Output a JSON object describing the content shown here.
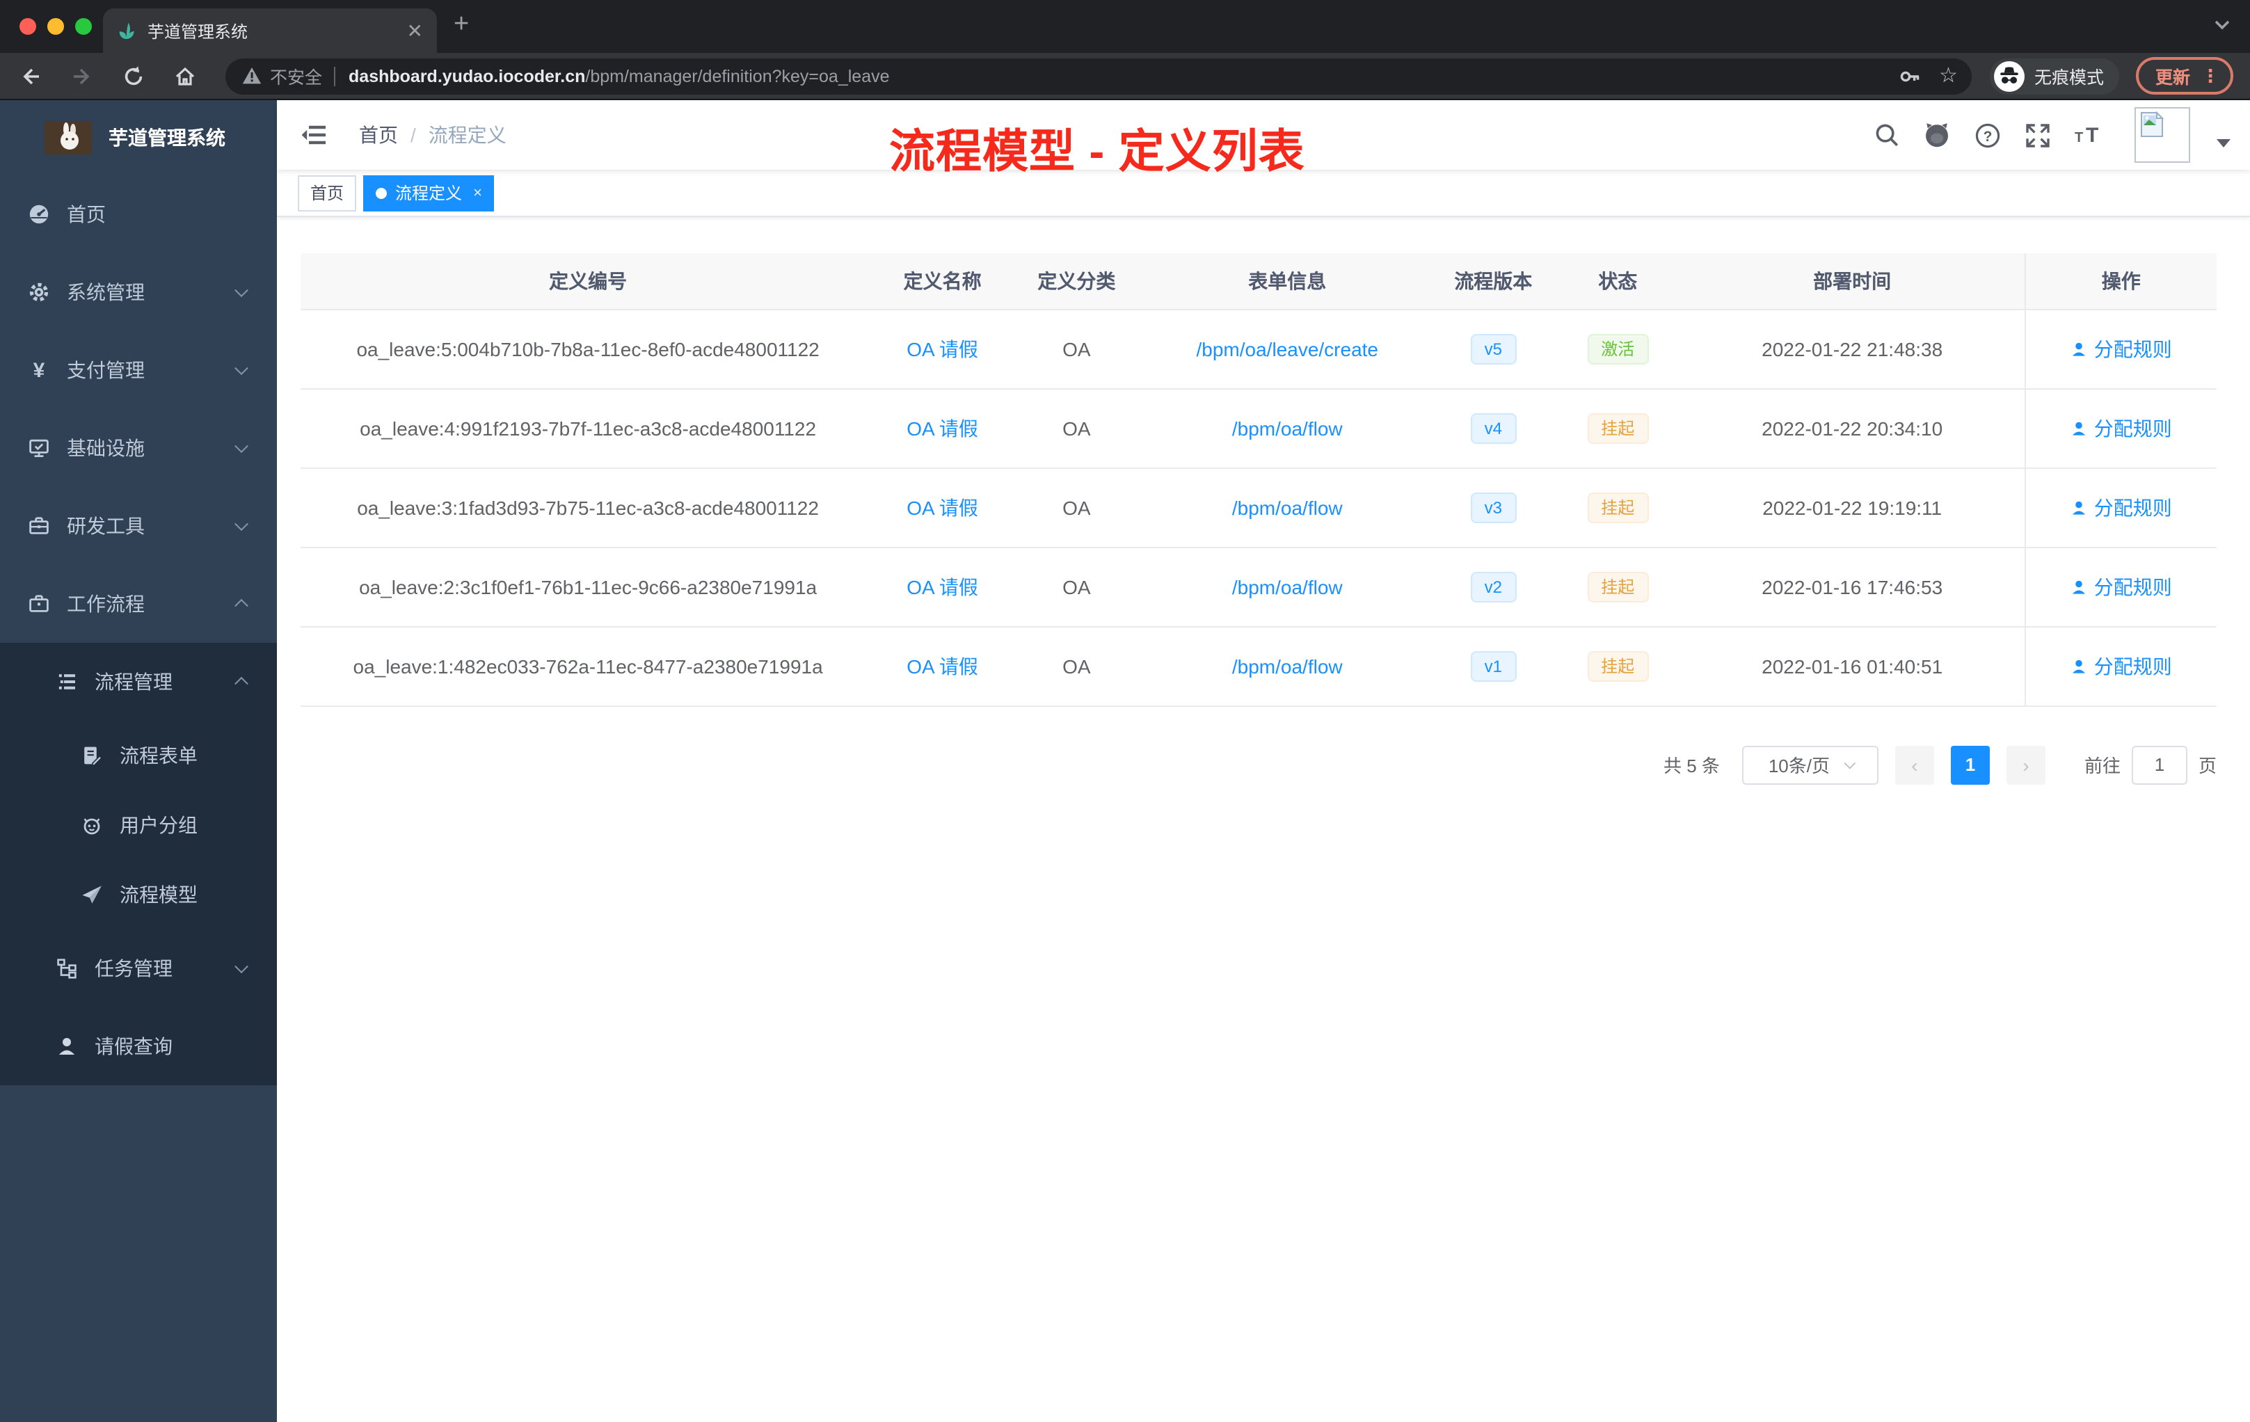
{
  "colors": {
    "accent": "#1890ff",
    "success": "#67c23a",
    "warning": "#e6a23c",
    "annotation_red": "#f5291c",
    "sidebar_bg": "#304156",
    "submenu_bg": "#1f2d3d"
  },
  "browser": {
    "tab_title": "芋道管理系统",
    "address": {
      "security": "不安全",
      "domain": "dashboard.yudao.iocoder.cn",
      "path": "/bpm/manager/definition?key=oa_leave"
    },
    "incognito_label": "无痕模式",
    "update_label": "更新",
    "menu_dots": "⋮"
  },
  "sidebar": {
    "logo_title": "芋道管理系统",
    "menu": [
      {
        "label": "首页",
        "icon": "dashboard-icon"
      },
      {
        "label": "系统管理",
        "icon": "gear-icon",
        "arrow": "down"
      },
      {
        "label": "支付管理",
        "icon": "yen-icon",
        "arrow": "down",
        "icon_glyph": "¥"
      },
      {
        "label": "基础设施",
        "icon": "monitor-icon",
        "arrow": "down"
      },
      {
        "label": "研发工具",
        "icon": "toolbox-icon",
        "arrow": "down"
      },
      {
        "label": "工作流程",
        "icon": "briefcase-icon",
        "arrow": "up",
        "expanded": true
      },
      {
        "label": "流程管理",
        "icon": "list-icon",
        "arrow": "up",
        "expanded": true
      },
      {
        "label": "流程表单",
        "icon": "form-icon"
      },
      {
        "label": "用户分组",
        "icon": "robot-icon"
      },
      {
        "label": "流程模型",
        "icon": "plane-icon"
      },
      {
        "label": "任务管理",
        "icon": "tree-icon",
        "arrow": "down"
      },
      {
        "label": "请假查询",
        "icon": "user-icon"
      }
    ]
  },
  "header": {
    "breadcrumb": {
      "home": "首页",
      "separator": "/",
      "current": "流程定义"
    },
    "annotation": "流程模型 - 定义列表"
  },
  "tags": {
    "items": [
      {
        "label": "首页",
        "active": false
      },
      {
        "label": "流程定义",
        "active": true,
        "closable": true,
        "close_glyph": "×"
      }
    ]
  },
  "table": {
    "headers": [
      "定义编号",
      "定义名称",
      "定义分类",
      "表单信息",
      "流程版本",
      "状态",
      "部署时间",
      "操作"
    ],
    "rows": [
      {
        "id": "oa_leave:5:004b710b-7b8a-11ec-8ef0-acde48001122",
        "name": "OA 请假",
        "category": "OA",
        "form": "/bpm/oa/leave/create",
        "version": "v5",
        "status": "激活",
        "status_type": "success",
        "deployed": "2022-01-22 21:48:38",
        "action": "分配规则"
      },
      {
        "id": "oa_leave:4:991f2193-7b7f-11ec-a3c8-acde48001122",
        "name": "OA 请假",
        "category": "OA",
        "form": "/bpm/oa/flow",
        "version": "v4",
        "status": "挂起",
        "status_type": "warning",
        "deployed": "2022-01-22 20:34:10",
        "action": "分配规则"
      },
      {
        "id": "oa_leave:3:1fad3d93-7b75-11ec-a3c8-acde48001122",
        "name": "OA 请假",
        "category": "OA",
        "form": "/bpm/oa/flow",
        "version": "v3",
        "status": "挂起",
        "status_type": "warning",
        "deployed": "2022-01-22 19:19:11",
        "action": "分配规则"
      },
      {
        "id": "oa_leave:2:3c1f0ef1-76b1-11ec-9c66-a2380e71991a",
        "name": "OA 请假",
        "category": "OA",
        "form": "/bpm/oa/flow",
        "version": "v2",
        "status": "挂起",
        "status_type": "warning",
        "deployed": "2022-01-16 17:46:53",
        "action": "分配规则"
      },
      {
        "id": "oa_leave:1:482ec033-762a-11ec-8477-a2380e71991a",
        "name": "OA 请假",
        "category": "OA",
        "form": "/bpm/oa/flow",
        "version": "v1",
        "status": "挂起",
        "status_type": "warning",
        "deployed": "2022-01-16 01:40:51",
        "action": "分配规则"
      }
    ]
  },
  "pagination": {
    "total": "共 5 条",
    "page_size": "10条/页",
    "prev": "‹",
    "page": "1",
    "next": "›",
    "goto": "前往",
    "goto_value": "1",
    "unit": "页"
  }
}
